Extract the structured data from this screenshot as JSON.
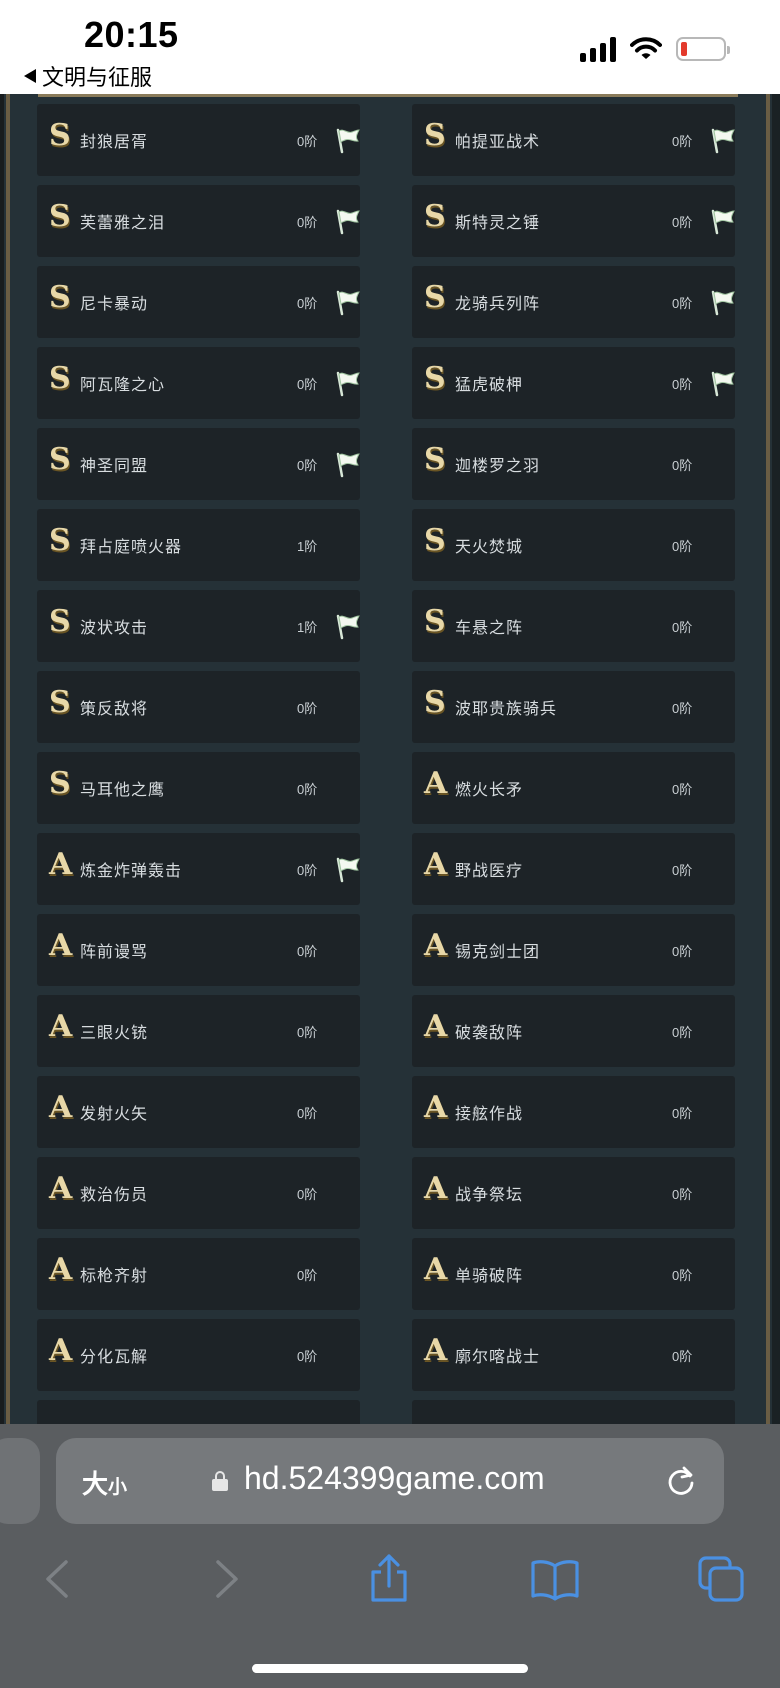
{
  "status_bar": {
    "time": "20:15",
    "back_app": "文明与征服"
  },
  "skills": [
    {
      "grade": "S",
      "name": "封狼居胥",
      "level": "0阶",
      "flag": true
    },
    {
      "grade": "S",
      "name": "帕提亚战术",
      "level": "0阶",
      "flag": true
    },
    {
      "grade": "S",
      "name": "芙蕾雅之泪",
      "level": "0阶",
      "flag": true
    },
    {
      "grade": "S",
      "name": "斯特灵之锤",
      "level": "0阶",
      "flag": true
    },
    {
      "grade": "S",
      "name": "尼卡暴动",
      "level": "0阶",
      "flag": true
    },
    {
      "grade": "S",
      "name": "龙骑兵列阵",
      "level": "0阶",
      "flag": true
    },
    {
      "grade": "S",
      "name": "阿瓦隆之心",
      "level": "0阶",
      "flag": true
    },
    {
      "grade": "S",
      "name": "猛虎破柙",
      "level": "0阶",
      "flag": true
    },
    {
      "grade": "S",
      "name": "神圣同盟",
      "level": "0阶",
      "flag": true
    },
    {
      "grade": "S",
      "name": "迦楼罗之羽",
      "level": "0阶",
      "flag": false
    },
    {
      "grade": "S",
      "name": "拜占庭喷火器",
      "level": "1阶",
      "flag": false
    },
    {
      "grade": "S",
      "name": "天火焚城",
      "level": "0阶",
      "flag": false
    },
    {
      "grade": "S",
      "name": "波状攻击",
      "level": "1阶",
      "flag": true
    },
    {
      "grade": "S",
      "name": "车悬之阵",
      "level": "0阶",
      "flag": false
    },
    {
      "grade": "S",
      "name": "策反敌将",
      "level": "0阶",
      "flag": false
    },
    {
      "grade": "S",
      "name": "波耶贵族骑兵",
      "level": "0阶",
      "flag": false
    },
    {
      "grade": "S",
      "name": "马耳他之鹰",
      "level": "0阶",
      "flag": false
    },
    {
      "grade": "A",
      "name": "燃火长矛",
      "level": "0阶",
      "flag": false
    },
    {
      "grade": "A",
      "name": "炼金炸弹轰击",
      "level": "0阶",
      "flag": true
    },
    {
      "grade": "A",
      "name": "野战医疗",
      "level": "0阶",
      "flag": false
    },
    {
      "grade": "A",
      "name": "阵前谩骂",
      "level": "0阶",
      "flag": false
    },
    {
      "grade": "A",
      "name": "锡克剑士团",
      "level": "0阶",
      "flag": false
    },
    {
      "grade": "A",
      "name": "三眼火铳",
      "level": "0阶",
      "flag": false
    },
    {
      "grade": "A",
      "name": "破袭敌阵",
      "level": "0阶",
      "flag": false
    },
    {
      "grade": "A",
      "name": "发射火矢",
      "level": "0阶",
      "flag": false
    },
    {
      "grade": "A",
      "name": "接舷作战",
      "level": "0阶",
      "flag": false
    },
    {
      "grade": "A",
      "name": "救治伤员",
      "level": "0阶",
      "flag": false
    },
    {
      "grade": "A",
      "name": "战争祭坛",
      "level": "0阶",
      "flag": false
    },
    {
      "grade": "A",
      "name": "标枪齐射",
      "level": "0阶",
      "flag": false
    },
    {
      "grade": "A",
      "name": "单骑破阵",
      "level": "0阶",
      "flag": false
    },
    {
      "grade": "A",
      "name": "分化瓦解",
      "level": "0阶",
      "flag": false
    },
    {
      "grade": "A",
      "name": "廓尔喀战士",
      "level": "0阶",
      "flag": false
    },
    {
      "grade": "",
      "name": "",
      "level": "",
      "flag": false
    },
    {
      "grade": "",
      "name": "",
      "level": "",
      "flag": false
    }
  ],
  "browser": {
    "text_size_large": "大",
    "text_size_small": "小",
    "url": "hd.524399game.com"
  },
  "colors": {
    "card_bg": "#1d2327",
    "panel_bg": "#253137",
    "grade_gold": "#e8d8a8",
    "browser_bg": "#5a5d60",
    "accent_blue": "#4a90e2"
  }
}
